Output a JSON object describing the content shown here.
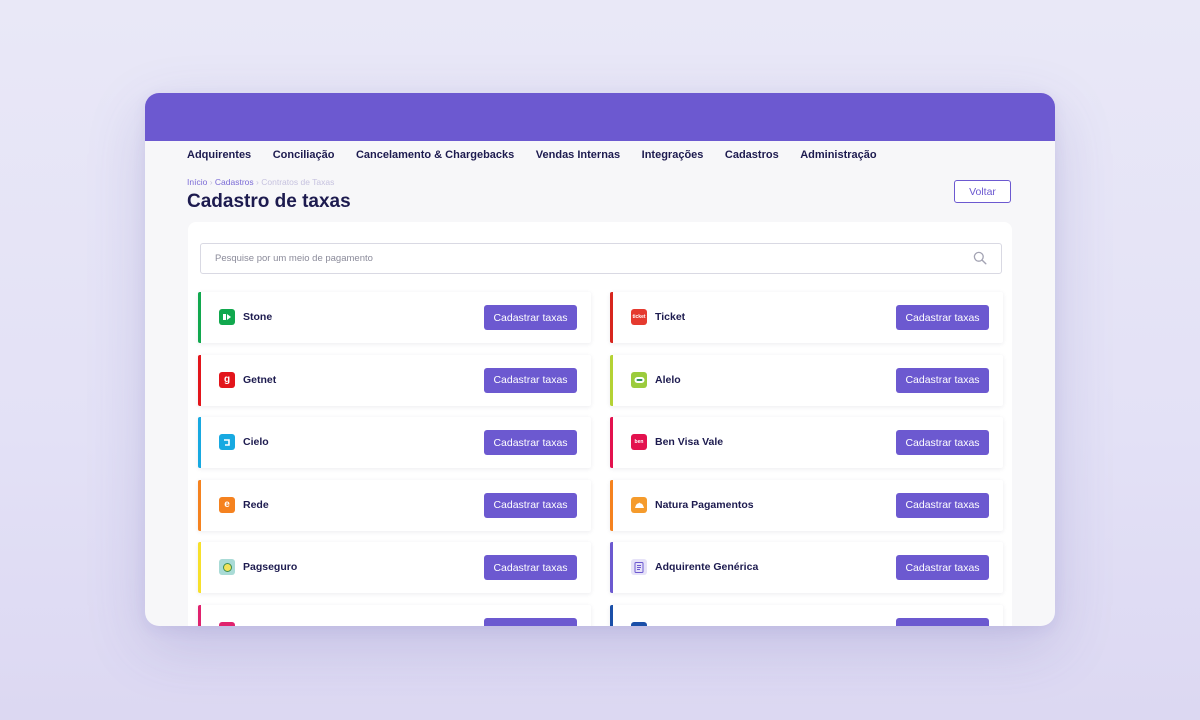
{
  "nav": {
    "items": [
      "Adquirentes",
      "Conciliação",
      "Cancelamento & Chargebacks",
      "Vendas Internas",
      "Integrações",
      "Cadastros",
      "Administração"
    ]
  },
  "breadcrumb": {
    "items": [
      "Início",
      "Cadastros",
      "Contratos de Taxas"
    ],
    "separator": "›"
  },
  "page": {
    "title": "Cadastro de taxas",
    "back_label": "Voltar"
  },
  "search": {
    "placeholder": "Pesquise por um meio de pagamento",
    "value": ""
  },
  "action_label": "Cadastrar taxas",
  "colors": {
    "brand": "#6c59d0",
    "title": "#1d1b4f"
  },
  "left_cards": [
    {
      "name": "Stone",
      "accent": "#11a84e",
      "logo_bg": "#11a84e",
      "logo": "stone-logo-icon"
    },
    {
      "name": "Getnet",
      "accent": "#e3151b",
      "logo_bg": "#e3151b",
      "logo": "getnet-logo-icon",
      "logo_text": "g"
    },
    {
      "name": "Cielo",
      "accent": "#17a9e1",
      "logo_bg": "#17a9e1",
      "logo": "cielo-logo-icon"
    },
    {
      "name": "Rede",
      "accent": "#f5821f",
      "logo_bg": "#f5821f",
      "logo": "rede-logo-icon",
      "logo_text": "e"
    },
    {
      "name": "Pagseguro",
      "accent": "#f7e02b",
      "logo_bg": "#a9dbd6",
      "logo": "pagseguro-logo-icon"
    },
    {
      "name": "",
      "accent": "#e0226e",
      "logo_bg": "#e0226e",
      "logo": "pink-logo-icon"
    }
  ],
  "right_cards": [
    {
      "name": "Ticket",
      "accent": "#d7261e",
      "logo_bg": "#e53a2f",
      "logo": "ticket-logo-icon",
      "logo_text": "ticket"
    },
    {
      "name": "Alelo",
      "accent": "#b4d234",
      "logo_bg": "#9ccc3d",
      "logo": "alelo-logo-icon"
    },
    {
      "name": "Ben Visa Vale",
      "accent": "#e3124e",
      "logo_bg": "#e3124e",
      "logo": "ben-logo-icon",
      "logo_text": "ben"
    },
    {
      "name": "Natura Pagamentos",
      "accent": "#f5821f",
      "logo_bg": "#f59b2c",
      "logo": "natura-logo-icon"
    },
    {
      "name": "Adquirente Genérica",
      "accent": "#6c59d0",
      "logo_bg": "#e6e2f8",
      "logo": "generic-document-icon"
    },
    {
      "name": "",
      "accent": "#1b4fa8",
      "logo_bg": "#1b4fa8",
      "logo": "blue-logo-icon"
    }
  ]
}
